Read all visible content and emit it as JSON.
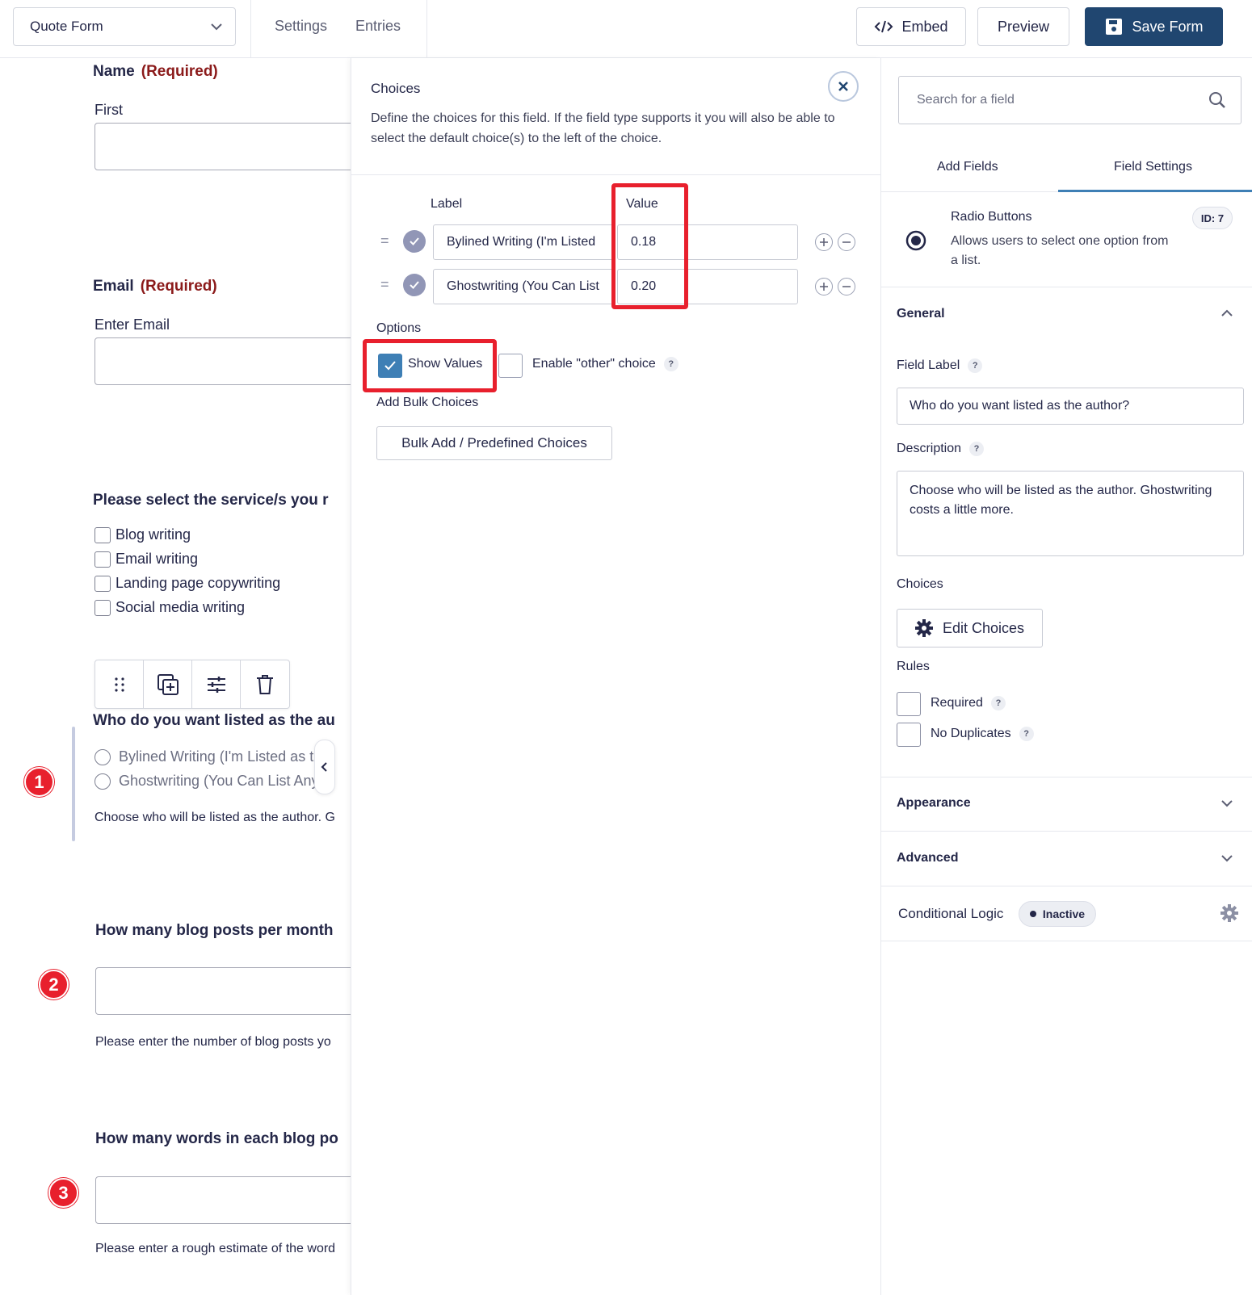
{
  "topbar": {
    "form_name": "Quote Form",
    "settings": "Settings",
    "entries": "Entries",
    "embed": "Embed",
    "preview": "Preview",
    "save": "Save Form"
  },
  "preview": {
    "name_label": "Name",
    "required": "(Required)",
    "first": "First",
    "email_label": "Email",
    "enter_email": "Enter Email",
    "services_label": "Please select the service/s you r",
    "services": [
      "Blog writing",
      "Email writing",
      "Landing page copywriting",
      "Social media writing"
    ],
    "author_label": "Who do you want listed as the au",
    "author_options": [
      "Bylined Writing (I'm Listed as the",
      "Ghostwriting (You Can List Any A"
    ],
    "author_desc": "Choose who will be listed as the author. G",
    "posts_label": "How many blog posts per month",
    "posts_desc": "Please enter the number of blog posts yo",
    "words_label": "How many words in each blog po",
    "words_desc": "Please enter a rough estimate of the word",
    "badges": [
      "1",
      "2",
      "3"
    ]
  },
  "choices": {
    "title": "Choices",
    "description": "Define the choices for this field. If the field type supports it you will also be able to select the default choice(s) to the left of the choice.",
    "col_label": "Label",
    "col_value": "Value",
    "rows": [
      {
        "label": "Bylined Writing (I'm Listed",
        "value": "0.18"
      },
      {
        "label": "Ghostwriting (You Can List",
        "value": "0.20"
      }
    ],
    "options_heading": "Options",
    "show_values": "Show Values",
    "enable_other": "Enable \"other\" choice",
    "bulk_heading": "Add Bulk Choices",
    "bulk_button": "Bulk Add / Predefined Choices"
  },
  "sidebar": {
    "search_placeholder": "Search for a field",
    "tab_add": "Add Fields",
    "tab_settings": "Field Settings",
    "field_type": "Radio Buttons",
    "field_type_desc": "Allows users to select one option from a list.",
    "field_id": "ID: 7",
    "general": "General",
    "field_label_h": "Field Label",
    "field_label_value": "Who do you want listed as the author?",
    "description_h": "Description",
    "description_value": "Choose who will be listed as the author. Ghostwriting costs a little more.",
    "choices_h": "Choices",
    "edit_choices": "Edit Choices",
    "rules_h": "Rules",
    "required": "Required",
    "no_duplicates": "No Duplicates",
    "appearance": "Appearance",
    "advanced": "Advanced",
    "conditional_logic": "Conditional Logic",
    "inactive": "Inactive",
    "help_mark": "?"
  },
  "colors": {
    "primary": "#204670",
    "accent": "#3e7fb5",
    "required": "#8b1a1a",
    "highlight": "#e8202d"
  }
}
